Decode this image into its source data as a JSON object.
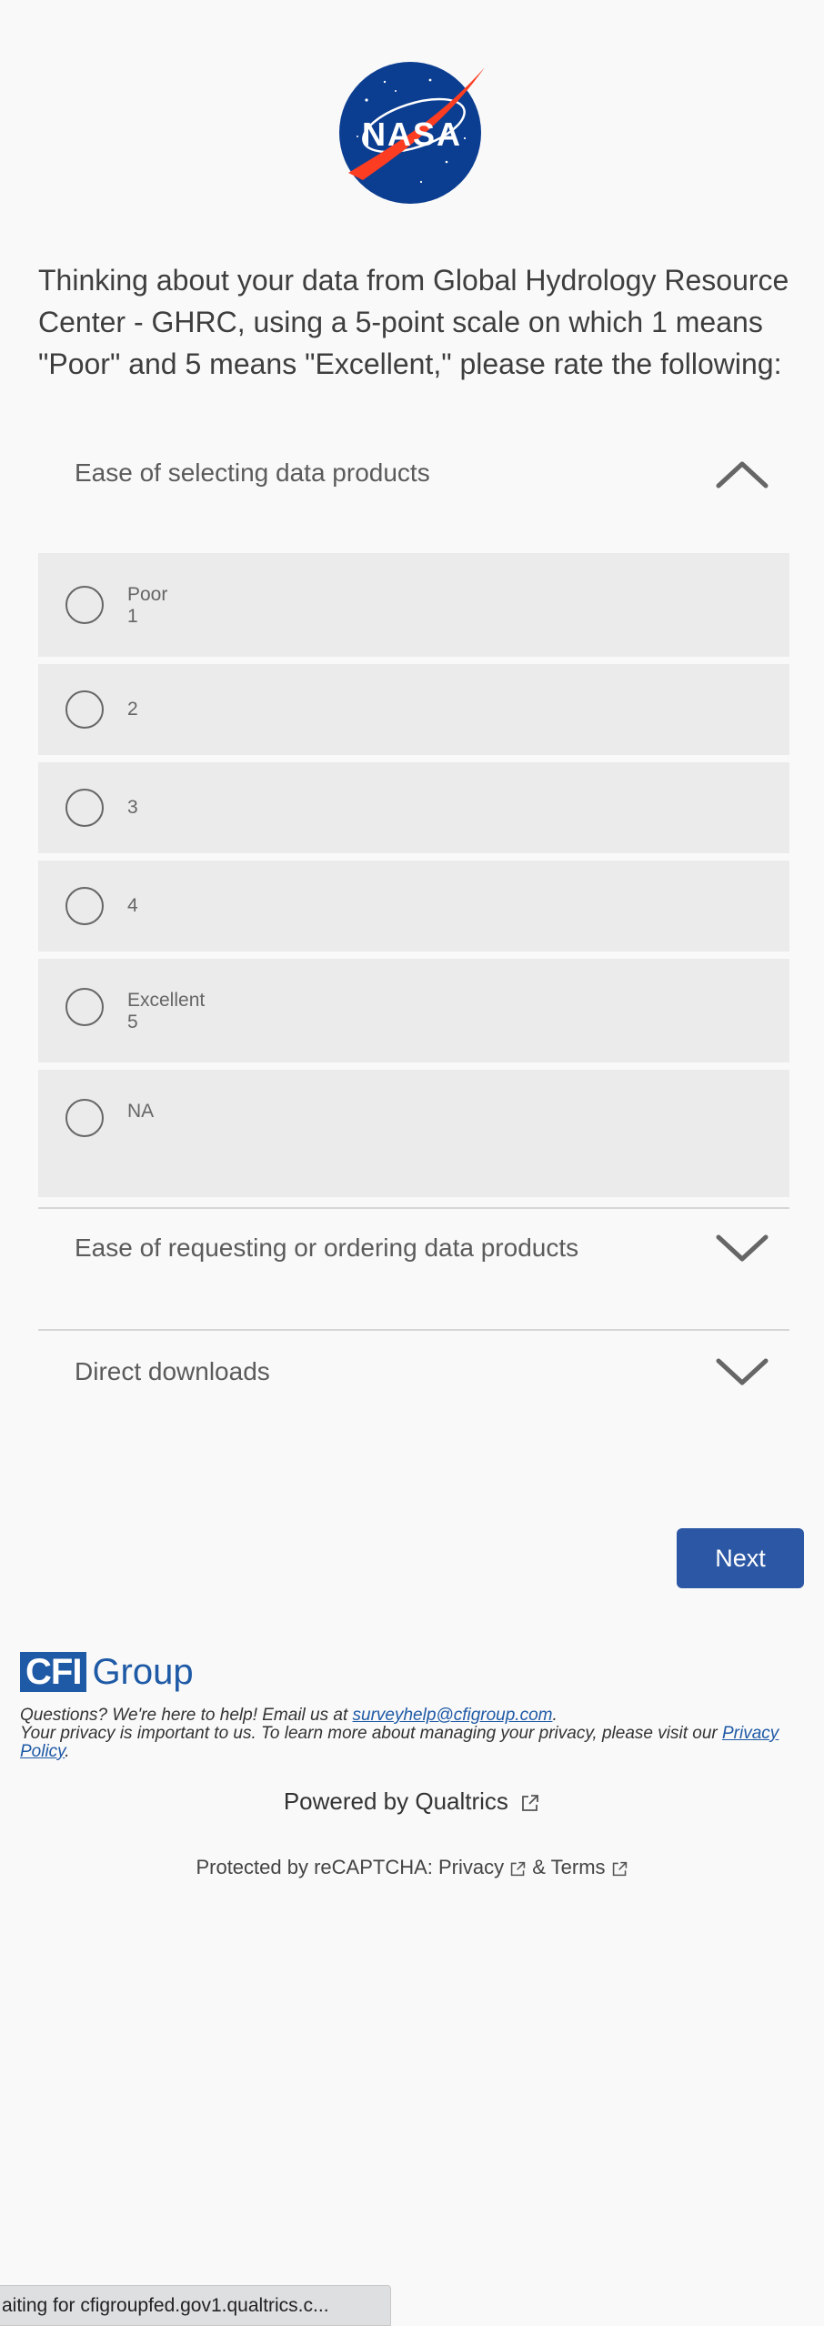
{
  "logo": {
    "text": "NASA",
    "color": "#0b3d91"
  },
  "question": "Thinking about your data from Global Hydrology Resource Center - GHRC, using a 5-point scale on which 1 means \"Poor\" and 5 means \"Excellent,\" please rate the following:",
  "items": [
    {
      "label": "Ease of selecting data products",
      "expanded": true,
      "chevron": "chevron-up-icon"
    },
    {
      "label": "Ease of requesting or ordering data products",
      "expanded": false,
      "chevron": "chevron-down-icon"
    },
    {
      "label": "Direct downloads",
      "expanded": false,
      "chevron": "chevron-down-icon"
    }
  ],
  "options": [
    {
      "line1": "Poor",
      "line2": "1"
    },
    {
      "line1": "2",
      "line2": ""
    },
    {
      "line1": "3",
      "line2": ""
    },
    {
      "line1": "4",
      "line2": ""
    },
    {
      "line1": "Excellent",
      "line2": "5"
    },
    {
      "line1": "NA",
      "line2": ""
    }
  ],
  "next_label": "Next",
  "footer": {
    "brand_box": "CFI",
    "brand_word": "Group",
    "help_prefix": "Questions? We're here to help! Email us at ",
    "help_email": "surveyhelp@cfigroup.com",
    "help_suffix": ".",
    "privacy_prefix": "Your privacy is important to us. To learn more about managing your privacy, please visit our ",
    "privacy_link": "Privacy Policy",
    "privacy_suffix": ".",
    "powered": "Powered by Qualtrics",
    "recaptcha_prefix": "Protected by reCAPTCHA: ",
    "recaptcha_privacy": "Privacy",
    "recaptcha_and": " & ",
    "recaptcha_terms": "Terms"
  },
  "status_bar": "aiting for cfigroupfed.gov1.qualtrics.c...",
  "colors": {
    "accent": "#2b57a4",
    "brand": "#1f5aa6",
    "option_bg": "#ebebeb"
  }
}
